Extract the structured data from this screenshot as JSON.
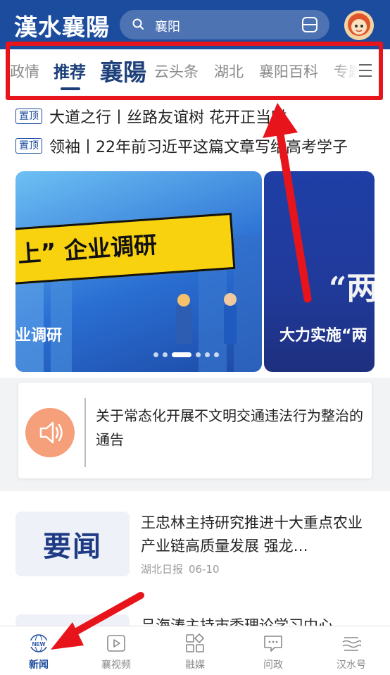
{
  "header": {
    "logo": "漢水襄陽",
    "search_text": "襄阳",
    "search_icon": "search-icon",
    "scan_icon": "scan-icon",
    "avatar_icon": "mascot-avatar"
  },
  "tabs": {
    "items": [
      "政情",
      "推荐",
      "襄陽",
      "云头条",
      "湖北",
      "襄阳百科",
      "专题"
    ],
    "active": "推荐",
    "menu_icon": "menu-icon"
  },
  "pinned": [
    {
      "tag": "置顶",
      "title": "大道之行丨丝路友谊树 花开正当时"
    },
    {
      "tag": "置顶",
      "title": "领袖丨22年前习近平这篇文章写给高考学子"
    }
  ],
  "carousel": {
    "slides": [
      {
        "caption": "业调研",
        "banner": "上” 企业调研"
      },
      {
        "caption": "大力实施“两",
        "side_text": "“两"
      }
    ],
    "dots": 6,
    "active_dot": 2
  },
  "notice": {
    "icon": "speaker-icon",
    "text": "关于常态化开展不文明交通违法行为整治的通告"
  },
  "news": [
    {
      "thumb_text": "要闻",
      "title": "王忠林主持研究推进十大重点农业产业链高质量发展 强龙…",
      "source": "湖北日报",
      "date": "06-10"
    },
    {
      "thumb_text": "",
      "title": "吕海涛主持市委理论学习中心"
    }
  ],
  "bottom_nav": [
    {
      "label": "新闻",
      "icon": "news-icon",
      "active": true
    },
    {
      "label": "襄视频",
      "icon": "video-icon",
      "active": false
    },
    {
      "label": "融媒",
      "icon": "media-grid-icon",
      "active": false
    },
    {
      "label": "问政",
      "icon": "message-icon",
      "active": false
    },
    {
      "label": "汉水号",
      "icon": "hanshui-icon",
      "active": false
    }
  ],
  "colors": {
    "header_bg": "#1c4c9e",
    "accent": "#1c3f7a",
    "annotation_red": "#e8141b",
    "notice_icon": "#f5a07b"
  }
}
